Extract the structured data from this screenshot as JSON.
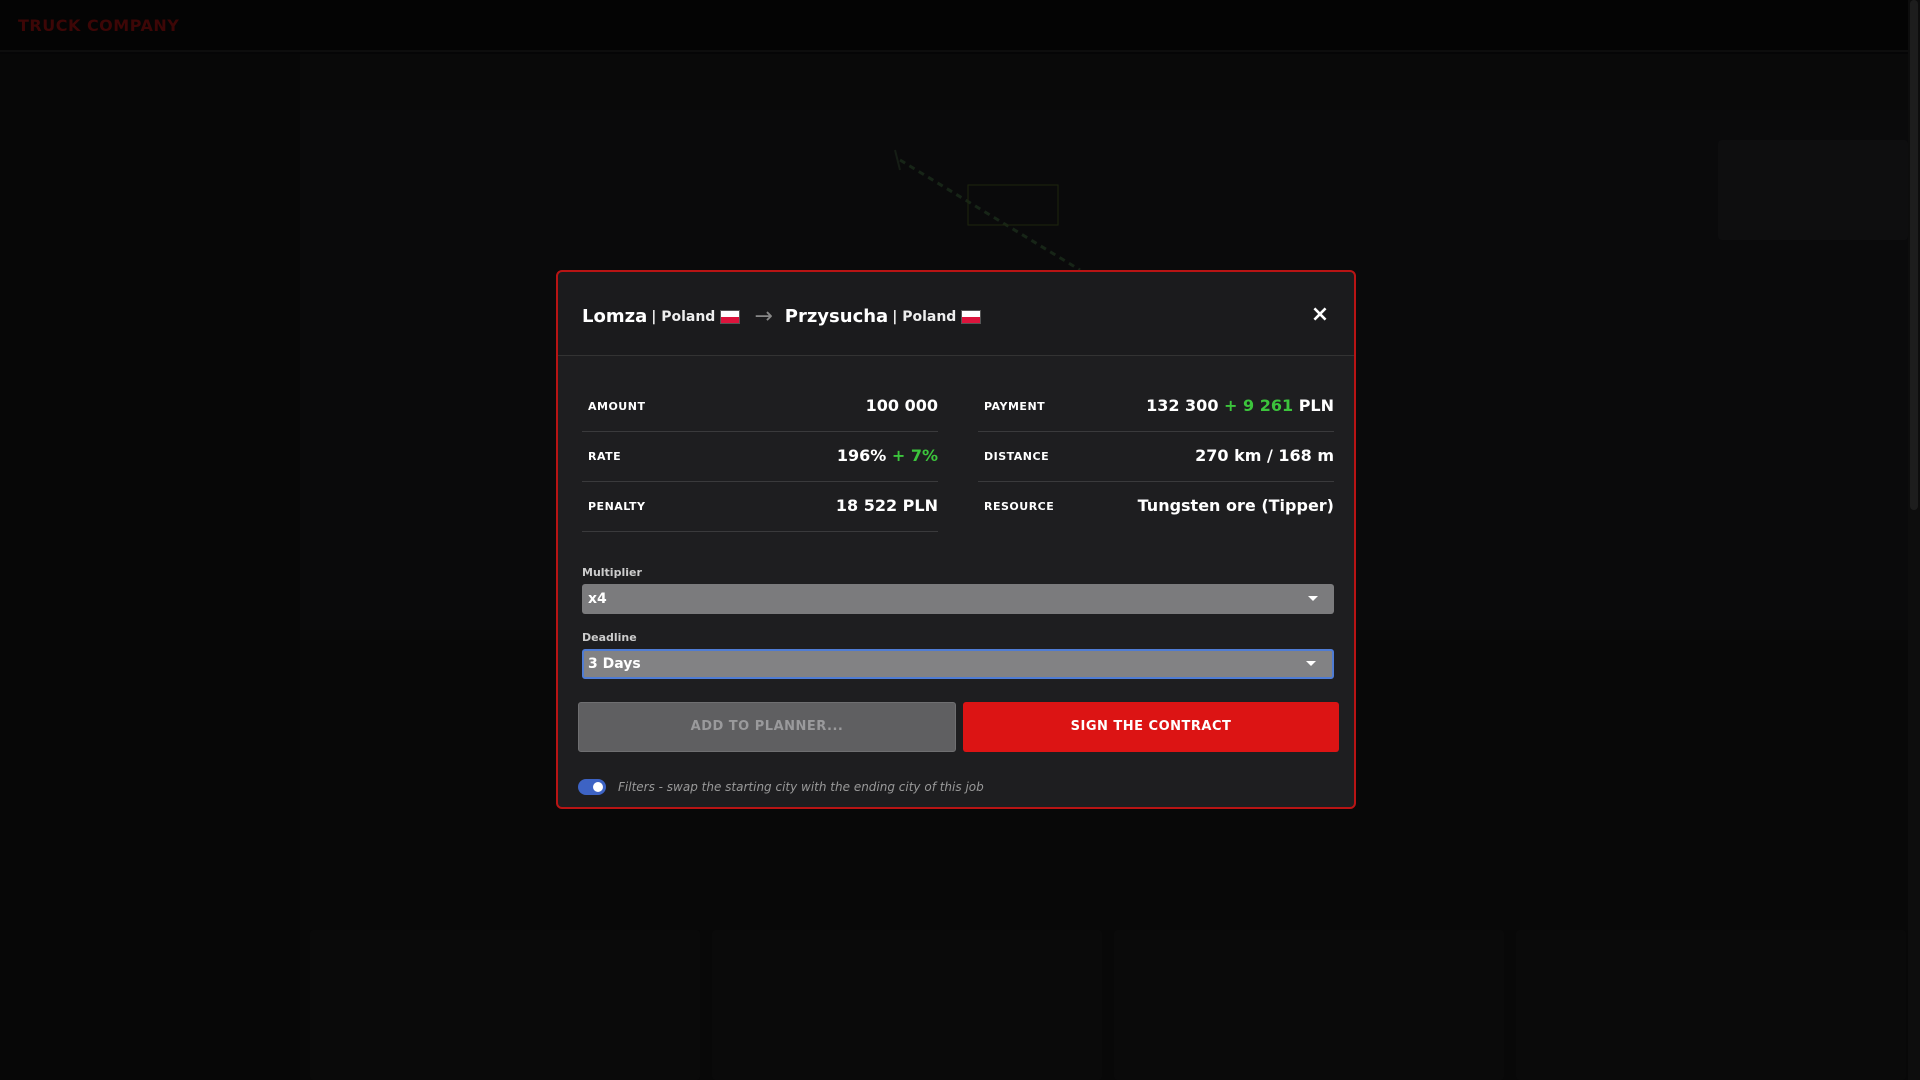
{
  "app": {
    "brand": "TRUCK COMPANY"
  },
  "modal": {
    "origin": {
      "city": "Lomza",
      "country": "| Poland"
    },
    "destination": {
      "city": "Przysucha",
      "country": "| Poland"
    },
    "arrow": "→",
    "close": "×",
    "stats": {
      "amount": {
        "label": "AMOUNT",
        "value": "100 000"
      },
      "payment": {
        "label": "PAYMENT",
        "value": "132 300",
        "bonus": "+ 9 261",
        "unit": "PLN"
      },
      "rate": {
        "label": "RATE",
        "value": "196%",
        "bonus": "+ 7%"
      },
      "distance": {
        "label": "DISTANCE",
        "value": "270 km / 168 m"
      },
      "penalty": {
        "label": "PENALTY",
        "value": "18 522 PLN"
      },
      "resource": {
        "label": "RESOURCE",
        "value": "Tungsten ore (Tipper)"
      }
    },
    "multiplier": {
      "label": "Multiplier",
      "value": "x4"
    },
    "deadline": {
      "label": "Deadline",
      "value": "3 Days"
    },
    "buttons": {
      "add_to_planner": "ADD TO PLANNER...",
      "sign": "SIGN THE CONTRACT"
    },
    "toggle": {
      "on": true,
      "text": "Filters - swap the starting city with the ending city of this job"
    }
  },
  "colors": {
    "accent_red": "#dc1414",
    "bonus_green": "#3cc43c",
    "penalty_yellow": "#e6b422",
    "toggle_blue": "#3d63c4"
  }
}
